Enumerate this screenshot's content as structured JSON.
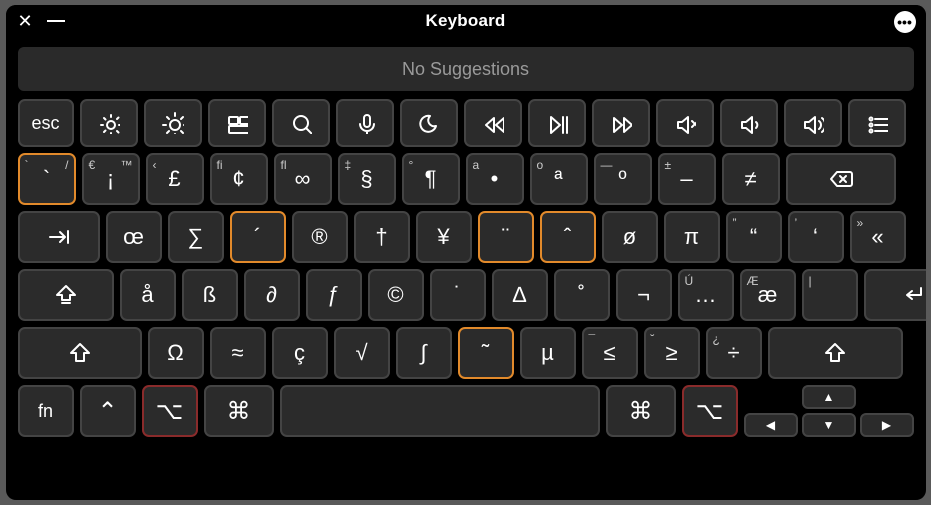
{
  "titlebar": {
    "title": "Keyboard"
  },
  "suggestions": {
    "text": "No Suggestions"
  },
  "fn_row": {
    "esc": "esc",
    "icons": [
      "brightness-down",
      "brightness-up",
      "mission-control",
      "search",
      "mic",
      "dnd",
      "rewind",
      "play-pause",
      "fast-forward",
      "mute",
      "volume-down",
      "volume-up",
      "list"
    ]
  },
  "row_num": [
    {
      "main": "`",
      "tl": "`",
      "tr": "/",
      "hl": "orange"
    },
    {
      "main": "¡",
      "tl": "€",
      "tr": "™"
    },
    {
      "main": "£",
      "tl": "‹",
      "tr": ""
    },
    {
      "main": "¢",
      "tl": "fi",
      "tr": ""
    },
    {
      "main": "∞",
      "tl": "fl",
      "tr": ""
    },
    {
      "main": "§",
      "tl": "‡",
      "tr": ""
    },
    {
      "main": "¶",
      "tl": "°",
      "tr": ""
    },
    {
      "main": "•",
      "tl": "a",
      "tr": ""
    },
    {
      "main": "ª",
      "tl": "o",
      "tr": ""
    },
    {
      "main": "º",
      "tl": "—",
      "tr": ""
    },
    {
      "main": "–",
      "tl": "±",
      "tr": ""
    },
    {
      "main": "≠",
      "tl": "",
      "tr": ""
    }
  ],
  "row_q": [
    {
      "main": "œ"
    },
    {
      "main": "∑"
    },
    {
      "main": "´",
      "hl": "orange"
    },
    {
      "main": "®"
    },
    {
      "main": "†"
    },
    {
      "main": "¥"
    },
    {
      "main": "¨",
      "hl": "orange"
    },
    {
      "main": "ˆ",
      "hl": "orange"
    },
    {
      "main": "ø"
    },
    {
      "main": "π"
    },
    {
      "main": "“",
      "tl": "”"
    },
    {
      "main": "‘",
      "tl": "’"
    },
    {
      "main": "«",
      "tl": "»"
    }
  ],
  "row_a": [
    {
      "main": "å"
    },
    {
      "main": "ß"
    },
    {
      "main": "∂"
    },
    {
      "main": "ƒ"
    },
    {
      "main": "©"
    },
    {
      "main": "˙"
    },
    {
      "main": "∆"
    },
    {
      "main": "˚"
    },
    {
      "main": "¬"
    },
    {
      "main": "…",
      "tl": "Ú"
    },
    {
      "main": "æ",
      "tl": "Æ"
    },
    {
      "main": "",
      "tl": "|"
    }
  ],
  "row_z": [
    {
      "main": "Ω"
    },
    {
      "main": "≈"
    },
    {
      "main": "ç"
    },
    {
      "main": "√"
    },
    {
      "main": "∫"
    },
    {
      "main": "˜",
      "hl": "orange"
    },
    {
      "main": "µ"
    },
    {
      "main": "≤",
      "tl": "¯"
    },
    {
      "main": "≥",
      "tl": "˘"
    },
    {
      "main": "÷",
      "tl": "¿"
    }
  ],
  "row_bottom": {
    "fn": "fn",
    "ctrl": "⌃",
    "opt_left": "⌥",
    "cmd_left": "⌘",
    "cmd_right": "⌘",
    "opt_right": "⌥",
    "arrows": {
      "up": "▲",
      "left": "◀",
      "down": "▼",
      "right": "▶"
    }
  }
}
